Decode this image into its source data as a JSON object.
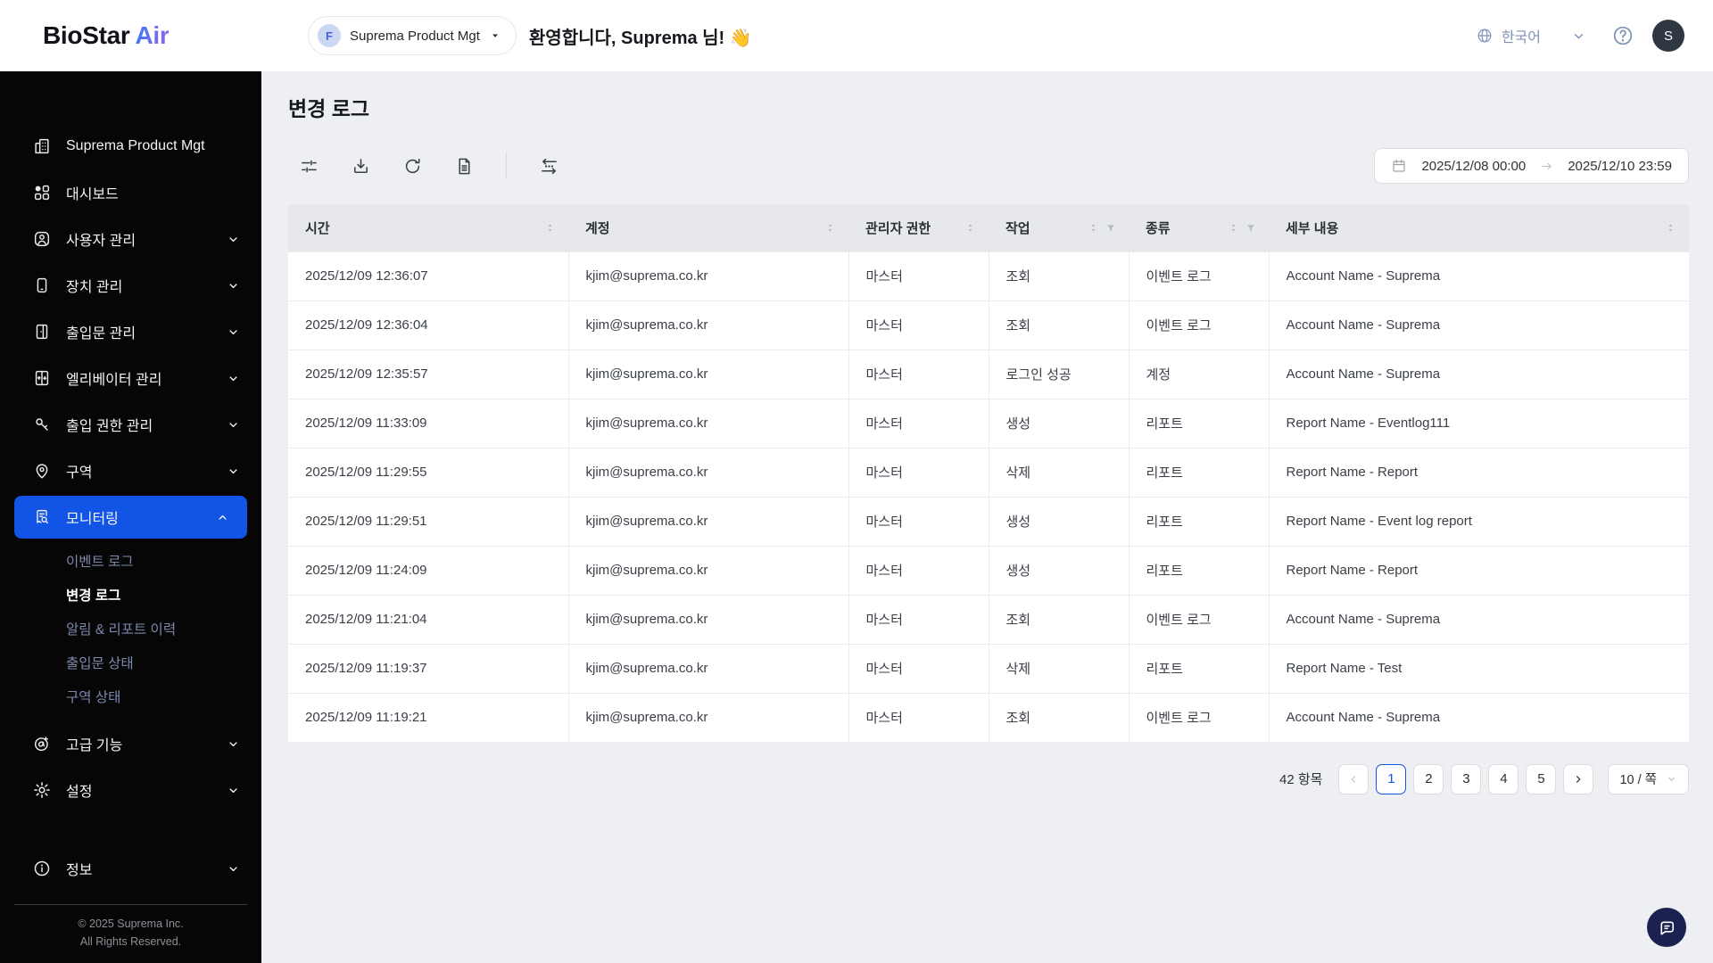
{
  "brand": {
    "name_primary": "BioStar",
    "name_secondary": "Air"
  },
  "header": {
    "org_selector": {
      "badge": "F",
      "label": "Suprema Product Mgt"
    },
    "welcome": "환영합니다, Suprema 님! 👋",
    "language": "한국어",
    "avatar_initial": "S"
  },
  "sidebar": {
    "items": [
      {
        "id": "suprema-product-mgt",
        "icon": "building-icon",
        "label": "Suprema Product Mgt"
      },
      {
        "id": "dashboard",
        "icon": "dashboard-icon",
        "label": "대시보드"
      },
      {
        "id": "user-management",
        "icon": "user-icon",
        "label": "사용자 관리",
        "chevron": "down"
      },
      {
        "id": "device-management",
        "icon": "device-icon",
        "label": "장치 관리",
        "chevron": "down"
      },
      {
        "id": "door-management",
        "icon": "door-icon",
        "label": "출입문 관리",
        "chevron": "down"
      },
      {
        "id": "elevator-management",
        "icon": "elevator-icon",
        "label": "엘리베이터 관리",
        "chevron": "down"
      },
      {
        "id": "access-permission",
        "icon": "key-icon",
        "label": "출입 권한 관리",
        "chevron": "down"
      },
      {
        "id": "zone",
        "icon": "location-pin-icon",
        "label": "구역",
        "chevron": "down"
      },
      {
        "id": "monitoring",
        "icon": "monitoring-icon",
        "label": "모니터링",
        "chevron": "up",
        "active": true,
        "submenu": [
          {
            "id": "event-log",
            "label": "이벤트 로그"
          },
          {
            "id": "change-log",
            "label": "변경 로그",
            "active": true
          },
          {
            "id": "alert-report-history",
            "label": "알림 & 리포트 이력"
          },
          {
            "id": "door-status",
            "label": "출입문 상태"
          },
          {
            "id": "zone-status",
            "label": "구역 상태"
          }
        ]
      },
      {
        "id": "advanced-features",
        "icon": "alpha-plus-icon",
        "label": "고급 기능",
        "chevron": "down"
      },
      {
        "id": "settings",
        "icon": "gear-icon",
        "label": "설정",
        "chevron": "down"
      }
    ],
    "bottom_item": {
      "id": "info",
      "icon": "info-icon",
      "label": "정보",
      "chevron": "down"
    },
    "footer_line1": "© 2025 Suprema Inc.",
    "footer_line2": "All Rights Reserved."
  },
  "page": {
    "title": "변경 로그"
  },
  "toolbar": {
    "buttons": [
      {
        "name": "filter-settings-button",
        "icon": "sliders-icon"
      },
      {
        "name": "download-button",
        "icon": "download-icon"
      },
      {
        "name": "refresh-button",
        "icon": "refresh-icon"
      },
      {
        "name": "report-button",
        "icon": "report-icon"
      },
      {
        "name": "column-settings-button",
        "icon": "column-swap-icon",
        "separated": true
      }
    ],
    "date_range": {
      "from": "2025/12/08 00:00",
      "to": "2025/12/10 23:59"
    }
  },
  "table": {
    "columns": [
      {
        "label": "시간",
        "sortable": true
      },
      {
        "label": "계정",
        "sortable": true
      },
      {
        "label": "관리자 권한",
        "sortable": true
      },
      {
        "label": "작업",
        "sortable": true,
        "filterable": true
      },
      {
        "label": "종류",
        "sortable": true,
        "filterable": true
      },
      {
        "label": "세부 내용",
        "sortable": true
      }
    ],
    "rows": [
      [
        "2025/12/09 12:36:07",
        "kjim@suprema.co.kr",
        "마스터",
        "조회",
        "이벤트 로그",
        "Account Name - Suprema"
      ],
      [
        "2025/12/09 12:36:04",
        "kjim@suprema.co.kr",
        "마스터",
        "조회",
        "이벤트 로그",
        "Account Name - Suprema"
      ],
      [
        "2025/12/09 12:35:57",
        "kjim@suprema.co.kr",
        "마스터",
        "로그인 성공",
        "계정",
        "Account Name - Suprema"
      ],
      [
        "2025/12/09 11:33:09",
        "kjim@suprema.co.kr",
        "마스터",
        "생성",
        "리포트",
        "Report Name - Eventlog111"
      ],
      [
        "2025/12/09 11:29:55",
        "kjim@suprema.co.kr",
        "마스터",
        "삭제",
        "리포트",
        "Report Name - Report"
      ],
      [
        "2025/12/09 11:29:51",
        "kjim@suprema.co.kr",
        "마스터",
        "생성",
        "리포트",
        "Report Name - Event log report"
      ],
      [
        "2025/12/09 11:24:09",
        "kjim@suprema.co.kr",
        "마스터",
        "생성",
        "리포트",
        "Report Name - Report"
      ],
      [
        "2025/12/09 11:21:04",
        "kjim@suprema.co.kr",
        "마스터",
        "조회",
        "이벤트 로그",
        "Account Name - Suprema"
      ],
      [
        "2025/12/09 11:19:37",
        "kjim@suprema.co.kr",
        "마스터",
        "삭제",
        "리포트",
        "Report Name - Test"
      ],
      [
        "2025/12/09 11:19:21",
        "kjim@suprema.co.kr",
        "마스터",
        "조회",
        "이벤트 로그",
        "Account Name - Suprema"
      ]
    ]
  },
  "pagination": {
    "total": "42 항목",
    "pages": [
      "1",
      "2",
      "3",
      "4",
      "5"
    ],
    "current": "1",
    "page_size": "10 / 쪽"
  },
  "colors": {
    "accent_blue": "#1254e6",
    "sidebar_bg": "#060607",
    "submenu_text": "#7c89ad",
    "header_muted": "#7e93b3",
    "logo_gradient_start": "#3f7bf5",
    "logo_gradient_end": "#8e62f2",
    "chat_fab": "#1b2150",
    "table_header_bg": "#e6e8ec",
    "page_bg": "#edeff2"
  }
}
